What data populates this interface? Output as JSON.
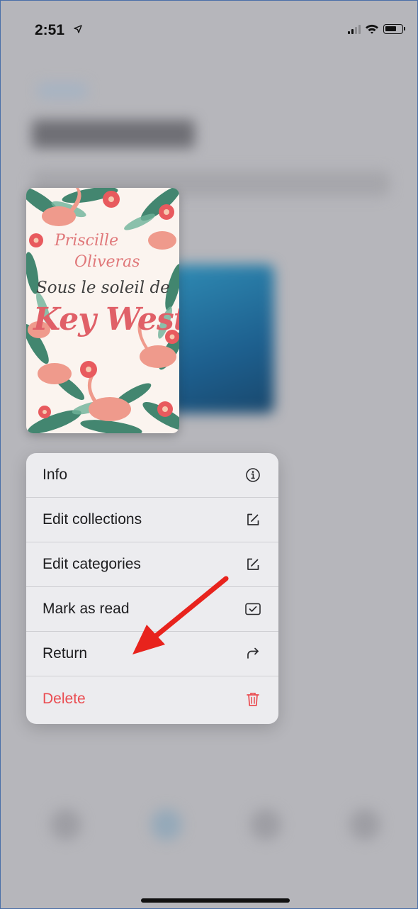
{
  "status_bar": {
    "time": "2:51",
    "icons": [
      "location-arrow-icon",
      "cellular-signal-icon",
      "wifi-icon",
      "battery-icon"
    ]
  },
  "book": {
    "author_line1": "Priscille",
    "author_line2": "Oliveras",
    "subtitle": "Sous le soleil de",
    "title": "Key West"
  },
  "context_menu": {
    "items": [
      {
        "label": "Info",
        "icon": "info-circle-icon"
      },
      {
        "label": "Edit collections",
        "icon": "edit-square-icon"
      },
      {
        "label": "Edit categories",
        "icon": "edit-square-icon"
      },
      {
        "label": "Mark as read",
        "icon": "checkbox-check-icon"
      },
      {
        "label": "Return",
        "icon": "return-arrow-icon"
      },
      {
        "label": "Delete",
        "icon": "trash-icon"
      }
    ]
  },
  "colors": {
    "destructive": "#ea4d52",
    "annotation_arrow": "#e8231d",
    "menu_background": "#ececef"
  }
}
